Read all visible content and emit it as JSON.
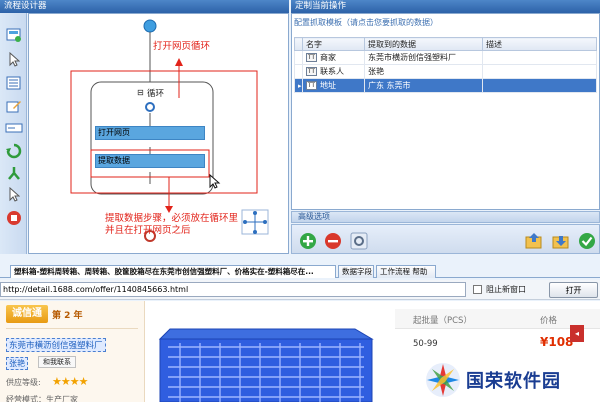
{
  "designer": {
    "title": "流程设计器",
    "loop_label": "循环",
    "step_open": "打开网页",
    "step_extract": "提取数据",
    "annotation_top": "打开网页循环",
    "annotation_bottom_1": "提取数据步骤，必须放在循环里",
    "annotation_bottom_2": "并且在打开网页之后",
    "collapse_symbol": "⊟"
  },
  "props": {
    "title": "定制当前操作",
    "hint": "配置抓取模板（请点击您要抓取的数据）",
    "columns": [
      "名字",
      "提取到的数据",
      "描述"
    ],
    "rows": [
      {
        "type": "TT",
        "name": "商家",
        "value": "东莞市横沥创信强塑料厂",
        "desc": ""
      },
      {
        "type": "TT",
        "name": "联系人",
        "value": "张艳",
        "desc": ""
      },
      {
        "type": "TT",
        "name": "地址",
        "value": "广东 东莞市",
        "desc": "",
        "selected": true
      }
    ],
    "advanced_label": "高级选项"
  },
  "tabs": [
    "塑料箱-塑料周转箱、周转箱、胶筐胶箱尽在东莞市创信强塑料厂、价格实在-塑料箱尽在...",
    "数据字段",
    "工作流程 帮助"
  ],
  "browser": {
    "url": "http://detail.1688.com/offer/1140845663.html",
    "popup_label": "阻止新窗口",
    "open_button": "打开"
  },
  "web": {
    "credit_logo": "诚信通",
    "credit_year": "第 2 年",
    "shop_name": "东莞市横沥创信强塑料厂",
    "contact_name": "张艳",
    "contact_button": "和我联系",
    "supply_level": "供应等级:",
    "stars": "★★★★",
    "business_mode": "经营模式：生产厂家",
    "min_order_label": "起批量（PCS）",
    "price_label": "价格",
    "qty_range": "50-99",
    "price_value": "¥108"
  },
  "watermark": "国荣软件园",
  "colors": {
    "header_blue": "#2d62a8",
    "annotation_red": "#e2231a",
    "step_blue": "#5aa6df",
    "selected_row": "#3f78c8"
  }
}
